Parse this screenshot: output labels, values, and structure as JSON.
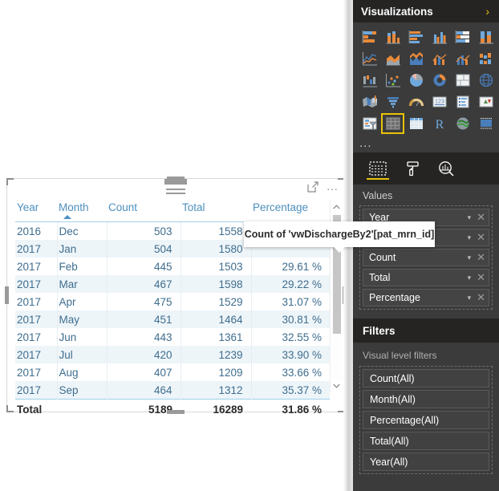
{
  "visual": {
    "title_icons": {
      "focus": "focus-mode",
      "more": "…"
    },
    "columns": [
      "Year",
      "Month",
      "Count",
      "Total",
      "Percentage"
    ],
    "sorted_column": "Month",
    "sort_direction": "ascending",
    "rows": [
      {
        "year": "2016",
        "month": "Dec",
        "count": "503",
        "total": "1558",
        "percentage": ""
      },
      {
        "year": "2017",
        "month": "Jan",
        "count": "504",
        "total": "1580",
        "percentage": ""
      },
      {
        "year": "2017",
        "month": "Feb",
        "count": "445",
        "total": "1503",
        "percentage": "29.61 %"
      },
      {
        "year": "2017",
        "month": "Mar",
        "count": "467",
        "total": "1598",
        "percentage": "29.22 %"
      },
      {
        "year": "2017",
        "month": "Apr",
        "count": "475",
        "total": "1529",
        "percentage": "31.07 %"
      },
      {
        "year": "2017",
        "month": "May",
        "count": "451",
        "total": "1464",
        "percentage": "30.81 %"
      },
      {
        "year": "2017",
        "month": "Jun",
        "count": "443",
        "total": "1361",
        "percentage": "32.55 %"
      },
      {
        "year": "2017",
        "month": "Jul",
        "count": "420",
        "total": "1239",
        "percentage": "33.90 %"
      },
      {
        "year": "2017",
        "month": "Aug",
        "count": "407",
        "total": "1209",
        "percentage": "33.66 %"
      },
      {
        "year": "2017",
        "month": "Sep",
        "count": "464",
        "total": "1312",
        "percentage": "35.37 %"
      }
    ],
    "total_row": {
      "label": "Total",
      "month": "",
      "count": "5189",
      "total": "16289",
      "percentage": "31.86 %"
    }
  },
  "tooltip": {
    "text": "Count of 'vwDischargeBy2'[pat_mrn_id]"
  },
  "panel": {
    "title": "Visualizations",
    "collapse_icon": "›",
    "viz_icons": [
      "stacked-bar-chart-icon",
      "stacked-column-chart-icon",
      "clustered-bar-chart-icon",
      "clustered-column-chart-icon",
      "hundred-percent-stacked-bar-chart-icon",
      "hundred-percent-stacked-column-chart-icon",
      "line-chart-icon",
      "area-chart-icon",
      "stacked-area-chart-icon",
      "line-and-stacked-column-chart-icon",
      "line-and-clustered-column-chart-icon",
      "ribbon-chart-icon",
      "waterfall-chart-icon",
      "scatter-chart-icon",
      "pie-chart-icon",
      "donut-chart-icon",
      "treemap-icon",
      "map-icon",
      "filled-map-icon",
      "funnel-chart-icon",
      "gauge-chart-icon",
      "card-icon",
      "multi-row-card-icon",
      "kpi-icon",
      "slicer-icon",
      "table-icon",
      "matrix-icon",
      "r-script-visual-icon",
      "arcgis-maps-icon",
      "power-apps-visual-icon"
    ],
    "selected_viz": "table-icon",
    "more_visuals": "...",
    "tabs": [
      {
        "name": "fields-tab",
        "icon": "fields-icon",
        "active": true
      },
      {
        "name": "format-tab",
        "icon": "paint-roller-icon",
        "active": false
      },
      {
        "name": "analytics-tab",
        "icon": "magnifier-chart-icon",
        "active": false
      }
    ],
    "values_label": "Values",
    "values_fields": [
      {
        "label": "Year"
      },
      {
        "label": "Month"
      },
      {
        "label": "Count"
      },
      {
        "label": "Total"
      },
      {
        "label": "Percentage"
      }
    ],
    "field_dropdown_icon": "▾",
    "field_remove_icon": "✕",
    "filters_title": "Filters",
    "visual_level_label": "Visual level filters",
    "filter_items": [
      {
        "label": "Count(All)"
      },
      {
        "label": "Month(All)"
      },
      {
        "label": "Percentage(All)"
      },
      {
        "label": "Total(All)"
      },
      {
        "label": "Year(All)"
      }
    ]
  },
  "colors": {
    "accent_yellow": "#e8c20a",
    "panel_bg": "#3b3b3b",
    "panel_header_bg": "#252423",
    "table_header_text": "#4d8fbe",
    "table_cell_text": "#3e6d8e",
    "table_alt_row": "#eef5f9"
  }
}
